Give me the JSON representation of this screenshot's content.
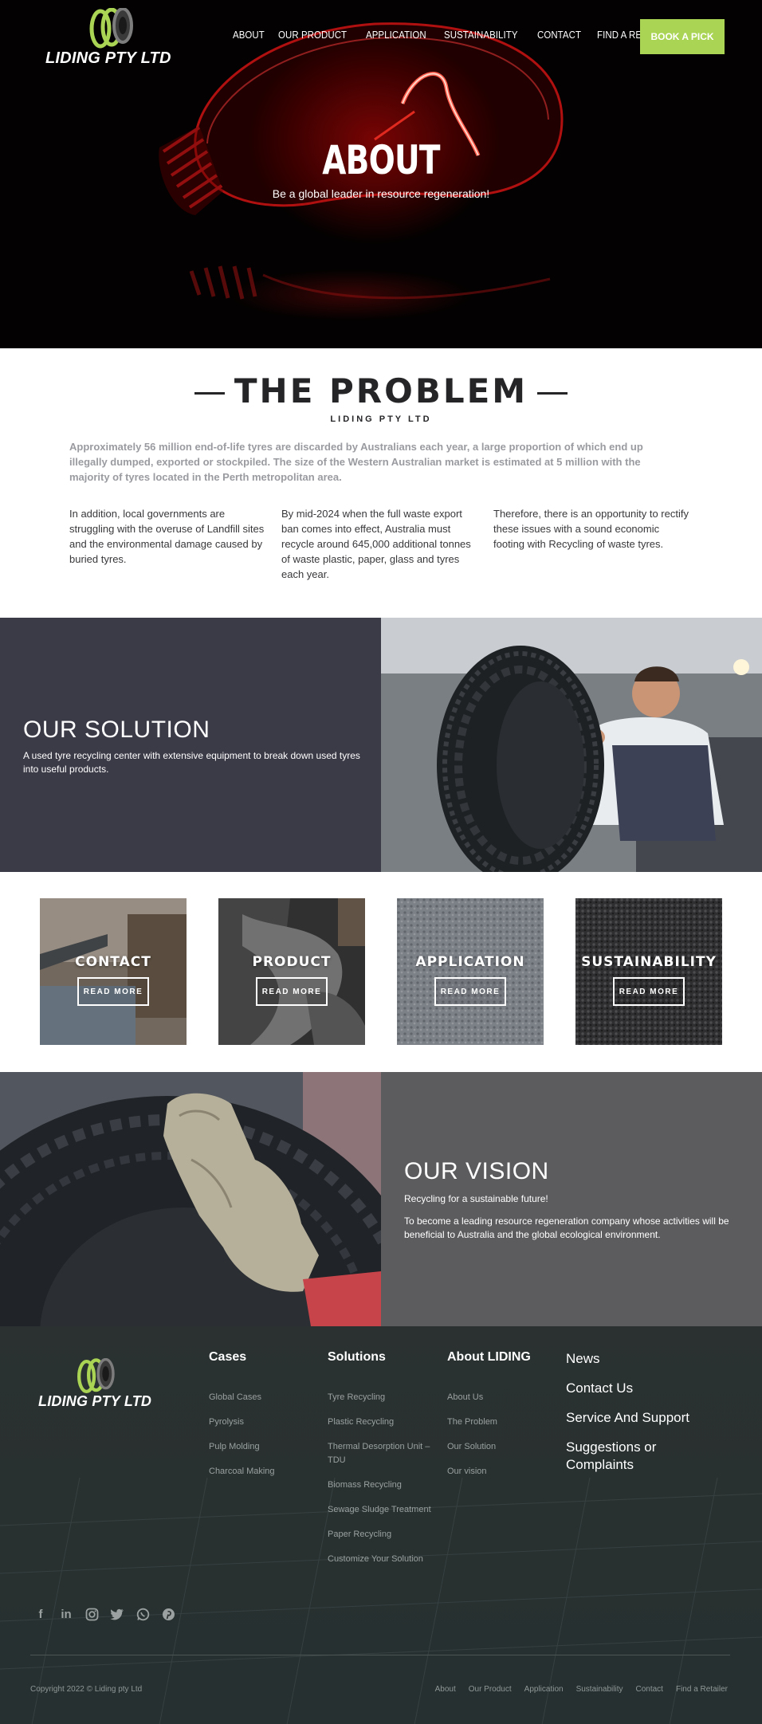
{
  "header": {
    "logo_text": "LIDING PTY LTD",
    "nav": [
      "ABOUT",
      "OUR PRODUCT",
      "APPLICATION",
      "SUSTAINABILITY",
      "CONTACT",
      "FIND A RETAILER"
    ],
    "cta": "BOOK A PICK"
  },
  "hero": {
    "title": "ABOUT",
    "subtitle": "Be a global leader in resource regeneration!"
  },
  "problem": {
    "title": "THE PROBLEM",
    "subtitle": "LIDING PTY LTD",
    "lead": "Approximately 56 million end-of-life tyres are discarded by Australians each year, a large proportion of which end up illegally dumped, exported or stockpiled. The size of the Western Australian market is estimated at 5 million with the majority of tyres located in the Perth metropolitan area.",
    "columns": [
      "In addition, local governments are struggling with the overuse of Landfill sites and the environmental damage caused by buried tyres.",
      "By mid-2024 when the full waste export ban comes into effect, Australia must recycle around 645,000 additional tonnes of waste plastic, paper, glass and tyres each year.",
      "Therefore, there is an opportunity to rectify these issues with a sound economic footing with Recycling of waste tyres."
    ]
  },
  "solution": {
    "title": "OUR SOLUTION",
    "text": "A used tyre recycling center with extensive equipment to break down used tyres into useful products."
  },
  "cards": [
    {
      "title": "CONTACT",
      "button": "READ MORE"
    },
    {
      "title": "PRODUCT",
      "button": "READ MORE"
    },
    {
      "title": "APPLICATION",
      "button": "READ MORE"
    },
    {
      "title": "SUSTAINABILITY",
      "button": "READ MORE"
    }
  ],
  "vision": {
    "title": "OUR VISION",
    "tagline": "Recycling for a sustainable future!",
    "text": "To become a leading resource regeneration company whose activities will be beneficial to Australia and the global ecological environment."
  },
  "footer": {
    "logo_text": "LIDING PTY LTD",
    "cases": {
      "title": "Cases",
      "items": [
        "Global Cases",
        "Pyrolysis",
        "Pulp Molding",
        "Charcoal Making"
      ]
    },
    "solutions": {
      "title": "Solutions",
      "items": [
        "Tyre Recycling",
        "Plastic Recycling",
        "Thermal Desorption Unit – TDU",
        "Biomass Recycling",
        "Sewage Sludge Treatment",
        "Paper Recycling",
        "Customize Your Solution"
      ]
    },
    "about": {
      "title": "About LIDING",
      "items": [
        "About Us",
        "The Problem",
        "Our Solution",
        "Our vision"
      ]
    },
    "big_links": [
      "News",
      "Contact Us",
      "Service And Support",
      "Suggestions or Complaints"
    ],
    "social_icons": [
      "facebook-icon",
      "linkedin-icon",
      "instagram-icon",
      "twitter-icon",
      "whatsapp-icon",
      "pinterest-icon"
    ],
    "copyright": "Copyright 2022 © Liding pty Ltd",
    "bottom_links": [
      "About",
      "Our Product",
      "Application",
      "Sustainability",
      "Contact",
      "Find a Retailer"
    ]
  },
  "colors": {
    "accent_green": "#a9d454",
    "solution_bg": "#3b3a47",
    "vision_bg": "#5c5c5f",
    "footer_bg": "#2b3131"
  }
}
